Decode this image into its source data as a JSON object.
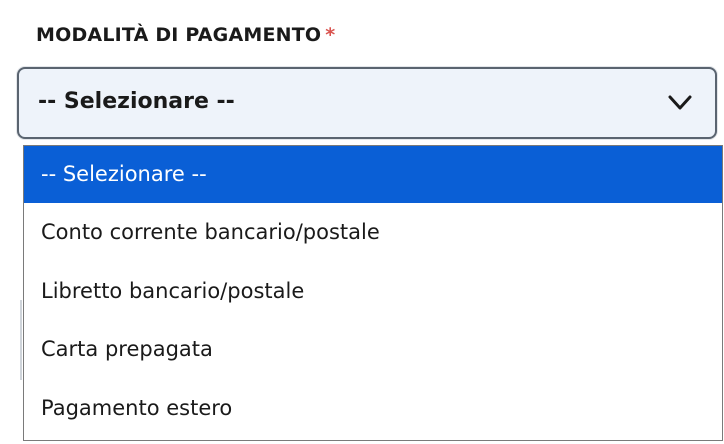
{
  "field": {
    "label": "MODALITÀ DI PAGAMENTO",
    "required_marker": "*"
  },
  "select": {
    "value": "-- Selezionare --",
    "icon": "chevron-down-icon"
  },
  "options": [
    {
      "label": "-- Selezionare --",
      "selected": true
    },
    {
      "label": "Conto corrente bancario/postale",
      "selected": false
    },
    {
      "label": "Libretto bancario/postale",
      "selected": false
    },
    {
      "label": "Carta prepagata",
      "selected": false
    },
    {
      "label": "Pagamento estero",
      "selected": false
    }
  ],
  "colors": {
    "highlight": "#0a5fd6",
    "required": "#d9534f",
    "select_bg": "#eef3fa"
  }
}
